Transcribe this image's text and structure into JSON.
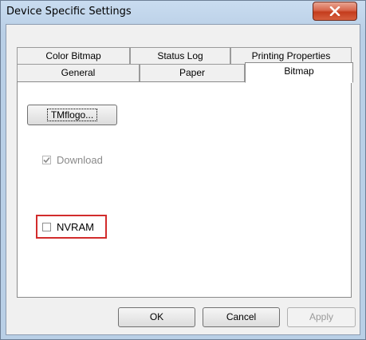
{
  "window": {
    "title": "Device Specific Settings",
    "close_label": "X"
  },
  "tabs": {
    "row1": [
      {
        "label": "Color Bitmap"
      },
      {
        "label": "Status Log"
      },
      {
        "label": "Printing Properties"
      }
    ],
    "row2": [
      {
        "label": "General"
      },
      {
        "label": "Paper"
      },
      {
        "label": "Bitmap",
        "selected": true
      }
    ]
  },
  "bitmap_panel": {
    "logo_button": "TMflogo...",
    "download": {
      "label": "Download",
      "checked": true,
      "enabled": false
    },
    "nvram": {
      "label": "NVRAM",
      "checked": false,
      "enabled": true
    }
  },
  "buttons": {
    "ok": "OK",
    "cancel": "Cancel",
    "apply": "Apply"
  },
  "colors": {
    "highlight": "#d22c2c",
    "close_button": "#c43c1d"
  }
}
